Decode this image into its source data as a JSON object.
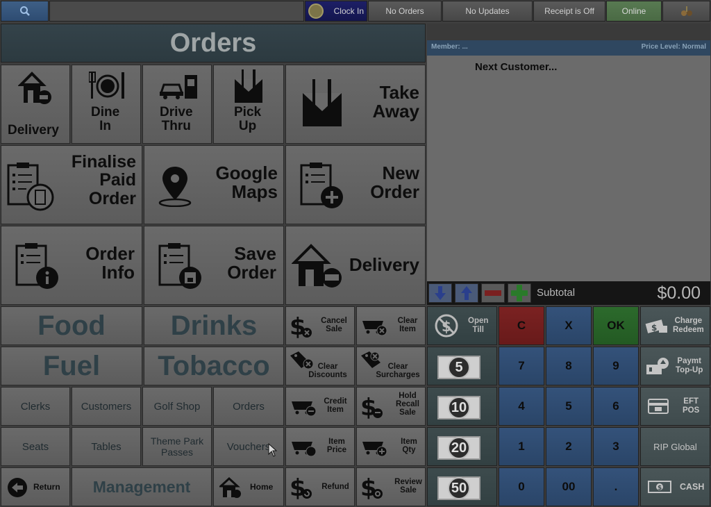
{
  "topbar": {
    "clock_in": "Clock In",
    "orders_status": "No Orders",
    "updates_status": "No Updates",
    "receipt_status": "Receipt is Off",
    "connection": "Online"
  },
  "orders_panel": {
    "title": "Orders",
    "tiles": {
      "delivery": "Delivery",
      "dine_in_1": "Dine",
      "dine_in_2": "In",
      "drive_thru_1": "Drive",
      "drive_thru_2": "Thru",
      "pick_up_1": "Pick",
      "pick_up_2": "Up",
      "take_away_1": "Take",
      "take_away_2": "Away",
      "finalise_1": "Finalise",
      "finalise_2": "Paid",
      "finalise_3": "Order",
      "google_1": "Google",
      "google_2": "Maps",
      "new_order_1": "New",
      "new_order_2": "Order",
      "order_info_1": "Order",
      "order_info_2": "Info",
      "save_order_1": "Save",
      "save_order_2": "Order",
      "delivery_big": "Delivery"
    }
  },
  "categories": {
    "food": "Food",
    "drinks": "Drinks",
    "fuel": "Fuel",
    "tobacco": "Tobacco",
    "clerks": "Clerks",
    "customers": "Customers",
    "golf_shop": "Golf Shop",
    "orders": "Orders",
    "seats": "Seats",
    "tables": "Tables",
    "theme_park_1": "Theme Park",
    "theme_park_2": "Passes",
    "vouchers": "Vouchers",
    "return": "Return",
    "management": "Management",
    "home": "Home"
  },
  "functions": {
    "cancel_sale_1": "Cancel",
    "cancel_sale_2": "Sale",
    "clear_item_1": "Clear",
    "clear_item_2": "Item",
    "clear_discounts_1": "Clear",
    "clear_discounts_2": "Discounts",
    "clear_surcharges_1": "Clear",
    "clear_surcharges_2": "Surcharges",
    "credit_item_1": "Credit",
    "credit_item_2": "Item",
    "hold_recall_1": "Hold",
    "hold_recall_2": "Recall",
    "hold_recall_3": "Sale",
    "item_price_1": "Item",
    "item_price_2": "Price",
    "item_qty_1": "Item",
    "item_qty_2": "Qty",
    "refund": "Refund",
    "review_sale_1": "Review",
    "review_sale_2": "Sale"
  },
  "receipt": {
    "member": "Member: ...",
    "price_level": "Price Level: Normal",
    "next_customer": "Next Customer...",
    "subtotal_label": "Subtotal",
    "subtotal_value": "$0.00"
  },
  "keypad": {
    "open_till_1": "Open",
    "open_till_2": "Till",
    "clear": "C",
    "cancel": "X",
    "ok": "OK",
    "charge_1": "Charge",
    "charge_2": "Redeem",
    "paymt_1": "Paymt",
    "paymt_2": "Top-Up",
    "eft_1": "EFT",
    "eft_2": "POS",
    "rip_global": "RIP Global",
    "cash": "CASH",
    "note_5": "5",
    "note_10": "10",
    "note_20": "20",
    "note_50": "50",
    "d7": "7",
    "d8": "8",
    "d9": "9",
    "d4": "4",
    "d5": "5",
    "d6": "6",
    "d1": "1",
    "d2": "2",
    "d3": "3",
    "d0": "0",
    "d00": "00",
    "dot": "."
  }
}
